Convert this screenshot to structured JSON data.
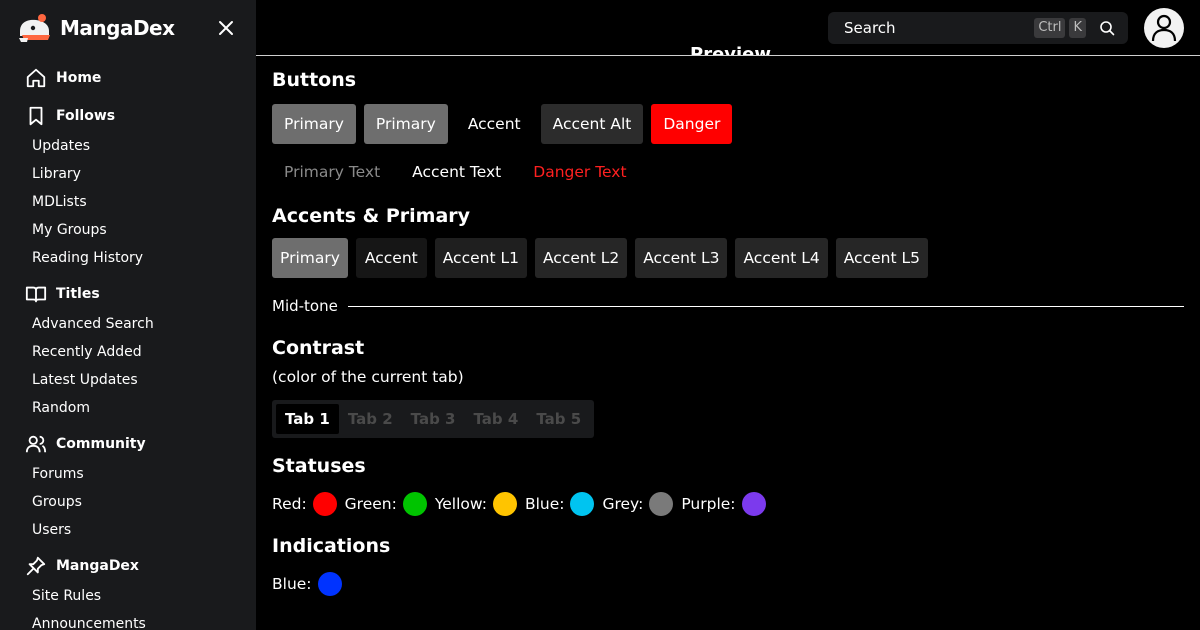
{
  "brand": {
    "name": "MangaDex"
  },
  "header": {
    "preview_label": "Preview",
    "search": {
      "placeholder": "Search",
      "kbd1": "Ctrl",
      "kbd2": "K"
    }
  },
  "sidebar": {
    "sections": [
      {
        "label": "Home",
        "icon": "home-icon",
        "items": []
      },
      {
        "label": "Follows",
        "icon": "bookmark-icon",
        "items": [
          "Updates",
          "Library",
          "MDLists",
          "My Groups",
          "Reading History"
        ]
      },
      {
        "label": "Titles",
        "icon": "book-open-icon",
        "items": [
          "Advanced Search",
          "Recently Added",
          "Latest Updates",
          "Random"
        ]
      },
      {
        "label": "Community",
        "icon": "users-icon",
        "items": [
          "Forums",
          "Groups",
          "Users"
        ]
      },
      {
        "label": "MangaDex",
        "icon": "pin-icon",
        "items": [
          "Site Rules",
          "Announcements"
        ]
      }
    ]
  },
  "main": {
    "buttons_title": "Buttons",
    "buttons": [
      "Primary",
      "Primary",
      "Accent",
      "Accent Alt",
      "Danger"
    ],
    "text_buttons": [
      "Primary Text",
      "Accent Text",
      "Danger Text"
    ],
    "accents_title": "Accents & Primary",
    "accents": [
      "Primary",
      "Accent",
      "Accent L1",
      "Accent L2",
      "Accent L3",
      "Accent L4",
      "Accent L5"
    ],
    "midtone": "Mid-tone",
    "contrast_title": "Contrast",
    "contrast_sub": "(color of the current tab)",
    "tabs": [
      "Tab 1",
      "Tab 2",
      "Tab 3",
      "Tab 4",
      "Tab 5"
    ],
    "statuses_title": "Statuses",
    "statuses": [
      {
        "label": "Red:",
        "color": "#ff0000"
      },
      {
        "label": "Green:",
        "color": "#00c400"
      },
      {
        "label": "Yellow:",
        "color": "#ffc400"
      },
      {
        "label": "Blue:",
        "color": "#00c4f0"
      },
      {
        "label": "Grey:",
        "color": "#7a7a7a"
      },
      {
        "label": "Purple:",
        "color": "#7c3aed"
      }
    ],
    "indications_title": "Indications",
    "indications": [
      {
        "label": "Blue:",
        "color": "#0033ff"
      }
    ]
  }
}
